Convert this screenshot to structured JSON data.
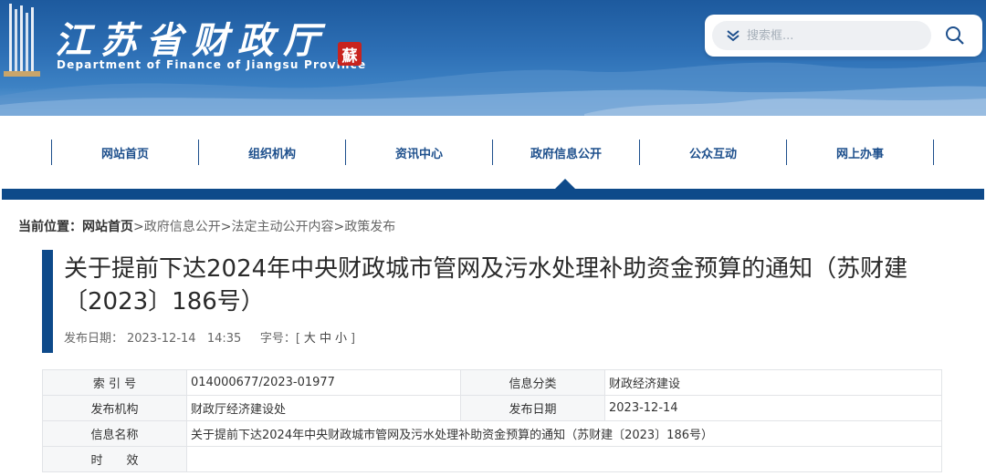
{
  "header": {
    "title": "江苏省财政厅",
    "subtitle": "Department of Finance of Jiangsu Province",
    "seal_text": "蘇",
    "search": {
      "placeholder": "搜索框..."
    },
    "icons": [
      "building-logo-icon",
      "chevron-down-icon",
      "search-icon"
    ]
  },
  "nav": {
    "items": [
      {
        "label": "网站首页"
      },
      {
        "label": "组织机构"
      },
      {
        "label": "资讯中心"
      },
      {
        "label": "政府信息公开"
      },
      {
        "label": "公众互动"
      },
      {
        "label": "网上办事"
      }
    ]
  },
  "breadcrumb": {
    "label": "当前位置：",
    "home": "网站首页",
    "sep": ">",
    "items": [
      "政府信息公开",
      "法定主动公开内容",
      "政策发布"
    ]
  },
  "article": {
    "title": "关于提前下达2024年中央财政城市管网及污水处理补助资金预算的通知（苏财建〔2023〕186号）",
    "meta": {
      "date_label": "发布日期：",
      "date": "2023-12-14",
      "time": "14:35",
      "size_label": "字号：[",
      "size_large": "大",
      "size_medium": "中",
      "size_small": "小",
      "size_close": "]"
    }
  },
  "info": {
    "rows": [
      {
        "k1": "索 引 号",
        "v1": "014000677/2023-01977",
        "k2": "信息分类",
        "v2": "财政经济建设"
      },
      {
        "k1": "发布机构",
        "v1": "财政厅经济建设处",
        "k2": "发布日期",
        "v2": "2023-12-14"
      },
      {
        "k1": "信息名称",
        "v1": "关于提前下达2024年中央财政城市管网及污水处理补助资金预算的通知（苏财建〔2023〕186号）"
      },
      {
        "k1": "时　　效",
        "v1": ""
      }
    ]
  },
  "colors": {
    "header_blue": "#1d5a9e",
    "nav_text": "#1d4f8c",
    "nav_bar": "#0e4a8a",
    "seal_red": "#c8231e"
  }
}
